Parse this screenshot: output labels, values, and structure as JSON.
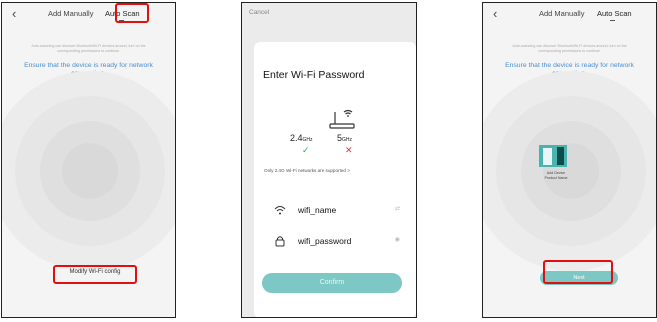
{
  "screen1": {
    "tabs": [
      "Add Manually",
      "Auto Scan"
    ],
    "hint_lines": [
      "Auto-scanning can discover Bluetooth/Wi-Fi devices around, turn on the",
      "corresponding permissions to continue."
    ],
    "ensure_text": "Ensure that the device is ready for network connection.",
    "modify_label": "Modify Wi-Fi config"
  },
  "screen2": {
    "cancel_label": "Cancel",
    "title": "Enter Wi-Fi Password",
    "band1": "2.4",
    "band1_unit": "GHz",
    "band2": "5",
    "band2_unit": "GHz",
    "band1_status": "✓",
    "band2_status": "✕",
    "note": "Only 2.4G Wi-Fi networks are supported >",
    "wifi_name": "wifi_name",
    "wifi_password": "wifi_password",
    "confirm_label": "Confirm"
  },
  "screen3": {
    "tabs": [
      "Add Manually",
      "Auto Scan"
    ],
    "hint_lines": [
      "Auto-scanning can discover Bluetooth/Wi-Fi devices around, turn on the",
      "corresponding permissions to continue."
    ],
    "ensure_text": "Ensure that the device is ready for network connection.",
    "device_caption": "Add Device Product Name",
    "next_label": "Next"
  },
  "colors": {
    "accent": "#7dc7c4",
    "link_blue": "#4a8fd4",
    "highlight_red": "#e01010",
    "check_green": "#2eab5a",
    "cross_red": "#e03a3a"
  }
}
